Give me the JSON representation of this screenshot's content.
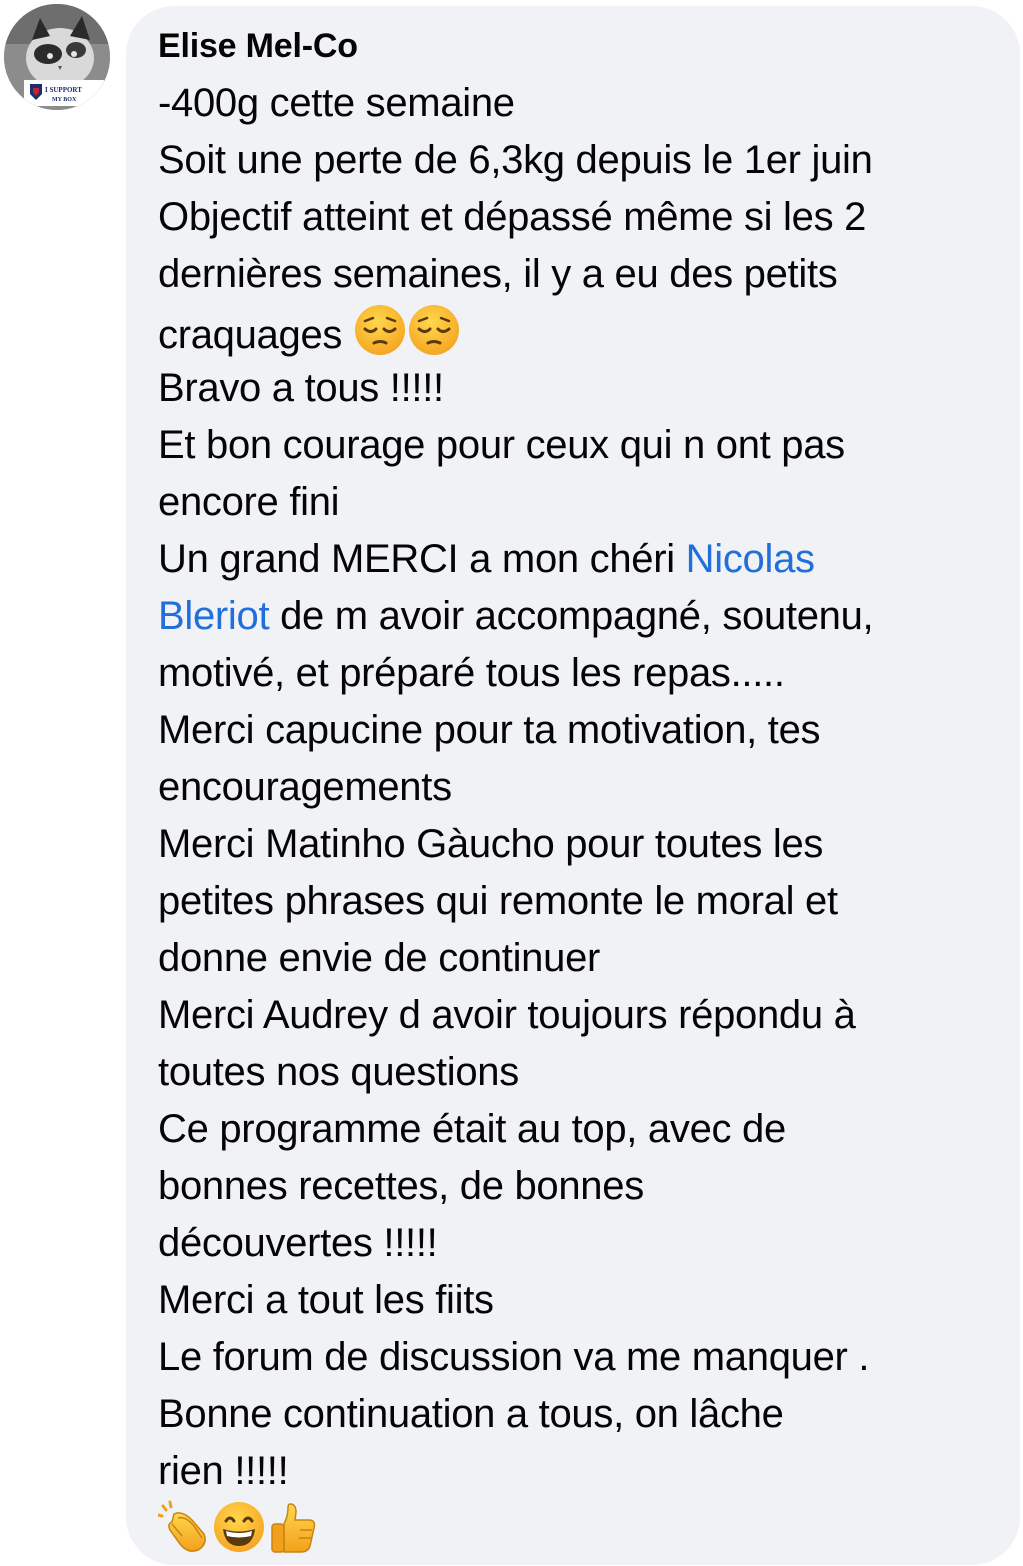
{
  "comment": {
    "author": "Elise Mel-Co",
    "avatar_badge_text": [
      "I SUPPORT",
      "MY BOX"
    ],
    "lines": [
      "-400g cette semaine",
      "Soit une perte de 6,3kg depuis le 1er juin",
      "Objectif atteint et dépassé même si les 2",
      "dernières semaines, il y a eu des petits",
      "craquages",
      "Bravo a tous !!!!!",
      "Et bon courage pour ceux qui n ont pas",
      "encore fini",
      "Un grand MERCI a mon chéri ",
      "Nicolas",
      "Bleriot",
      " de m avoir accompagné, soutenu,",
      "motivé, et préparé tous les repas.....",
      "Merci capucine pour ta motivation, tes",
      "encouragements",
      "Merci Matinho Gàucho pour toutes les",
      "petites phrases qui remonte le moral et",
      "donne envie de continuer",
      "Merci Audrey d avoir toujours répondu à",
      "toutes nos questions",
      "Ce programme était au top, avec de",
      "bonnes recettes, de bonnes",
      "découvertes !!!!!",
      "Merci a tout les fiits",
      "Le forum de discussion va me manquer .",
      "Bonne continuation a tous, on lâche",
      "rien !!!!!"
    ],
    "emojis": {
      "craquages": [
        "pensive-face",
        "pensive-face"
      ],
      "final": [
        "clapping-hands",
        "grinning-face",
        "thumbs-up"
      ]
    },
    "colors": {
      "bubble": "#f0f2f5",
      "text": "#050505",
      "mention": "#216fdb"
    }
  }
}
